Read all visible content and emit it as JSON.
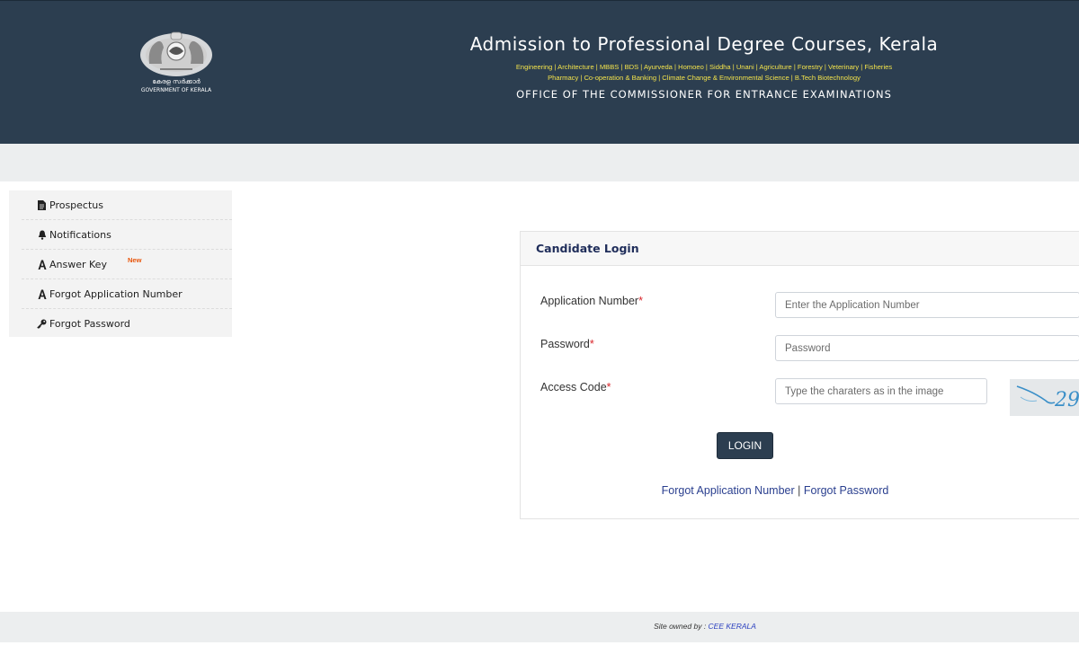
{
  "header": {
    "emblem_text_ml": "കേരള സർക്കാർ",
    "emblem_text_en": "GOVERNMENT OF KERALA",
    "title": "Admission to Professional Degree Courses, Kerala",
    "courses_line1": "Engineering | Architecture | MBBS | BDS | Ayurveda | Homoeo | Siddha | Unani | Agriculture | Forestry | Veterinary | Fisheries",
    "courses_line2": "Pharmacy | Co-operation & Banking | Climate Change & Environmental Science | B.Tech Biotechnology",
    "office": "OFFICE OF THE COMMISSIONER FOR ENTRANCE EXAMINATIONS"
  },
  "sidebar": {
    "items": [
      {
        "label": "Prospectus",
        "icon": "file-icon"
      },
      {
        "label": "Notifications",
        "icon": "bell-icon"
      },
      {
        "label": "Answer Key",
        "icon": "font-a-icon",
        "badge": "New"
      },
      {
        "label": "Forgot Application Number",
        "icon": "font-a-icon"
      },
      {
        "label": "Forgot Password",
        "icon": "key-icon"
      }
    ]
  },
  "login": {
    "title": "Candidate Login",
    "app_number_label": "Application Number",
    "app_number_placeholder": "Enter the Application Number",
    "password_label": "Password",
    "password_placeholder": "Password",
    "access_code_label": "Access Code",
    "access_code_placeholder": "Type the charaters as in the image",
    "required_mark": "*",
    "captcha_text": "29",
    "button_label": "LOGIN",
    "link_forgot_app": "Forgot Application Number",
    "link_sep": "|",
    "link_forgot_pw": "Forgot Password"
  },
  "footer": {
    "prefix": "Site owned by : ",
    "owner": "CEE KERALA"
  },
  "colors": {
    "header_bg": "#2c3e50",
    "courses_text": "#f2e24b",
    "accent_link": "#2a3f8f",
    "required": "#d9262b",
    "badge_new": "#e8540a"
  }
}
